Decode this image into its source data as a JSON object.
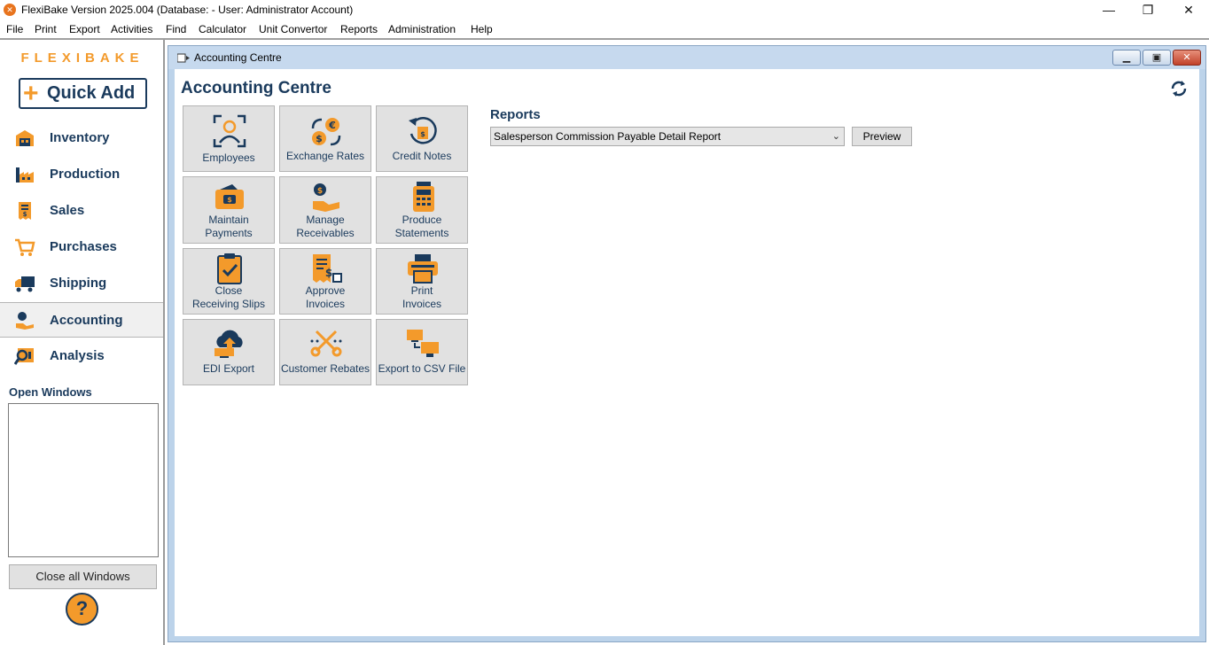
{
  "titlebar": {
    "title": "FlexiBake Version 2025.004 (Database:  - User: Administrator Account)",
    "minimize": "—",
    "restore": "❐",
    "close": "✕"
  },
  "menu": [
    "File",
    "Print",
    "Export",
    "Activities",
    "Find",
    "Calculator",
    "Unit Convertor",
    "Reports",
    "Administration",
    "Help"
  ],
  "sidebar": {
    "logo": "FLEXIBAKE",
    "quick_add": "Quick Add",
    "items": [
      {
        "label": "Inventory",
        "icon": "warehouse-icon"
      },
      {
        "label": "Production",
        "icon": "factory-icon"
      },
      {
        "label": "Sales",
        "icon": "receipt-icon"
      },
      {
        "label": "Purchases",
        "icon": "cart-icon"
      },
      {
        "label": "Shipping",
        "icon": "truck-icon"
      },
      {
        "label": "Accounting",
        "icon": "money-hand-icon"
      },
      {
        "label": "Analysis",
        "icon": "analysis-icon"
      }
    ],
    "active": "Accounting",
    "open_windows_label": "Open Windows",
    "close_all": "Close all Windows",
    "help": "?"
  },
  "child_window": {
    "title": "Accounting Centre",
    "page_title": "Accounting Centre",
    "tiles": [
      {
        "line1": "Employees",
        "line2": "",
        "icon": "employee-icon"
      },
      {
        "line1": "Exchange Rates",
        "line2": "",
        "icon": "exchange-icon"
      },
      {
        "line1": "Credit Notes",
        "line2": "",
        "icon": "credit-note-icon"
      },
      {
        "line1": "Maintain",
        "line2": "Payments",
        "icon": "wallet-icon"
      },
      {
        "line1": "Manage",
        "line2": "Receivables",
        "icon": "receivable-icon"
      },
      {
        "line1": "Produce",
        "line2": "Statements",
        "icon": "statement-icon"
      },
      {
        "line1": "Close",
        "line2": "Receiving Slips",
        "icon": "clipboard-check-icon"
      },
      {
        "line1": "Approve",
        "line2": "Invoices",
        "icon": "invoice-icon"
      },
      {
        "line1": "Print",
        "line2": "Invoices",
        "icon": "printer-icon"
      },
      {
        "line1": "EDI Export",
        "line2": "",
        "icon": "cloud-upload-icon"
      },
      {
        "line1": "Customer Rebates",
        "line2": "",
        "icon": "scissors-icon"
      },
      {
        "line1": "Export to CSV File",
        "line2": "",
        "icon": "computers-icon"
      }
    ],
    "reports_label": "Reports",
    "report_selected": "Salesperson Commission Payable Detail Report",
    "preview": "Preview"
  },
  "colors": {
    "navy": "#1a3a5c",
    "orange": "#f39a2b",
    "mdi_frame": "#bcd3ea"
  }
}
